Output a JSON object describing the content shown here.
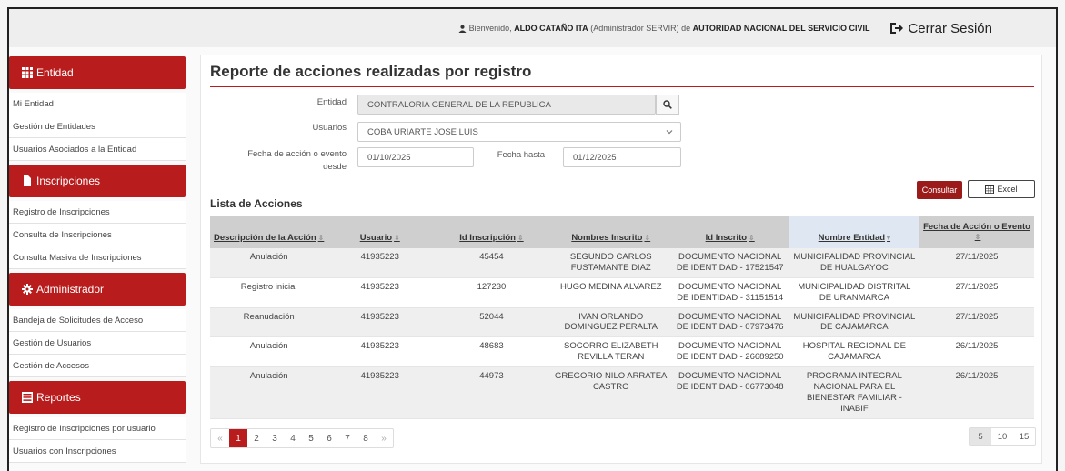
{
  "topbar": {
    "welcome": "Bienvenido,",
    "user_name": "ALDO CATAÑO ITA",
    "role": "(Administrador SERVIR) de",
    "organization": "AUTORIDAD NACIONAL DEL SERVICIO CIVIL",
    "logout_label": "Cerrar Sesión"
  },
  "sidebar": {
    "sections": [
      {
        "title": "Entidad",
        "icon": "grid-icon",
        "items": [
          "Mi Entidad",
          "Gestión de Entidades",
          "Usuarios Asociados a la Entidad"
        ]
      },
      {
        "title": "Inscripciones",
        "icon": "file-icon",
        "items": [
          "Registro de Inscripciones",
          "Consulta de Inscripciones",
          "Consulta Masiva de Inscripciones"
        ]
      },
      {
        "title": "Administrador",
        "icon": "gear-icon",
        "items": [
          "Bandeja de Solicitudes de Acceso",
          "Gestión de Usuarios",
          "Gestión de Accesos"
        ]
      },
      {
        "title": "Reportes",
        "icon": "list-icon",
        "items": [
          "Registro de Inscripciones por usuario",
          "Usuarios con Inscripciones"
        ]
      }
    ]
  },
  "page": {
    "title": "Reporte de acciones realizadas por registro",
    "form": {
      "entidad_label": "Entidad",
      "entidad_value": "CONTRALORIA GENERAL DE LA REPUBLICA",
      "usuarios_label": "Usuarios",
      "usuarios_value": "COBA URIARTE JOSE LUIS",
      "fecha_desde_label_1": "Fecha de acción o evento",
      "fecha_desde_label_2": "desde",
      "fecha_desde_value": "01/10/2025",
      "fecha_hasta_label": "Fecha hasta",
      "fecha_hasta_value": "01/12/2025"
    },
    "consultar_label": "Consultar",
    "excel_label": "Excel",
    "list_title": "Lista de Acciones"
  },
  "table": {
    "columns": [
      "Descripción de la Acción",
      "Usuario",
      "Id Inscripción",
      "Nombres Inscrito",
      "Id Inscrito",
      "Nombre Entidad",
      "Fecha de Acción o Evento"
    ],
    "rows": [
      [
        "Anulación",
        "41935223",
        "45454",
        "SEGUNDO CARLOS FUSTAMANTE DIAZ",
        "DOCUMENTO NACIONAL DE IDENTIDAD - 17521547",
        "MUNICIPALIDAD PROVINCIAL DE HUALGAYOC",
        "27/11/2025"
      ],
      [
        "Registro inicial",
        "41935223",
        "127230",
        "HUGO MEDINA ALVAREZ",
        "DOCUMENTO NACIONAL DE IDENTIDAD - 31151514",
        "MUNICIPALIDAD DISTRITAL DE URANMARCA",
        "27/11/2025"
      ],
      [
        "Reanudación",
        "41935223",
        "52044",
        "IVAN ORLANDO DOMINGUEZ PERALTA",
        "DOCUMENTO NACIONAL DE IDENTIDAD - 07973476",
        "MUNICIPALIDAD PROVINCIAL DE CAJAMARCA",
        "27/11/2025"
      ],
      [
        "Anulación",
        "41935223",
        "48683",
        "SOCORRO ELIZABETH REVILLA TERAN",
        "DOCUMENTO NACIONAL DE IDENTIDAD - 26689250",
        "HOSPITAL REGIONAL DE CAJAMARCA",
        "26/11/2025"
      ],
      [
        "Anulación",
        "41935223",
        "44973",
        "GREGORIO NILO ARRATEA CASTRO",
        "DOCUMENTO NACIONAL DE IDENTIDAD - 06773048",
        "PROGRAMA INTEGRAL NACIONAL PARA EL BIENESTAR FAMILIAR - INABIF",
        "26/11/2025"
      ]
    ]
  },
  "pagination": {
    "prev": "«",
    "pages": [
      "1",
      "2",
      "3",
      "4",
      "5",
      "6",
      "7",
      "8"
    ],
    "active_page": "1",
    "next": "»",
    "page_sizes": [
      "5",
      "10",
      "15"
    ],
    "active_size": "5"
  },
  "colors": {
    "accent": "#b91c1c",
    "header_bg": "#cfcfcf"
  }
}
